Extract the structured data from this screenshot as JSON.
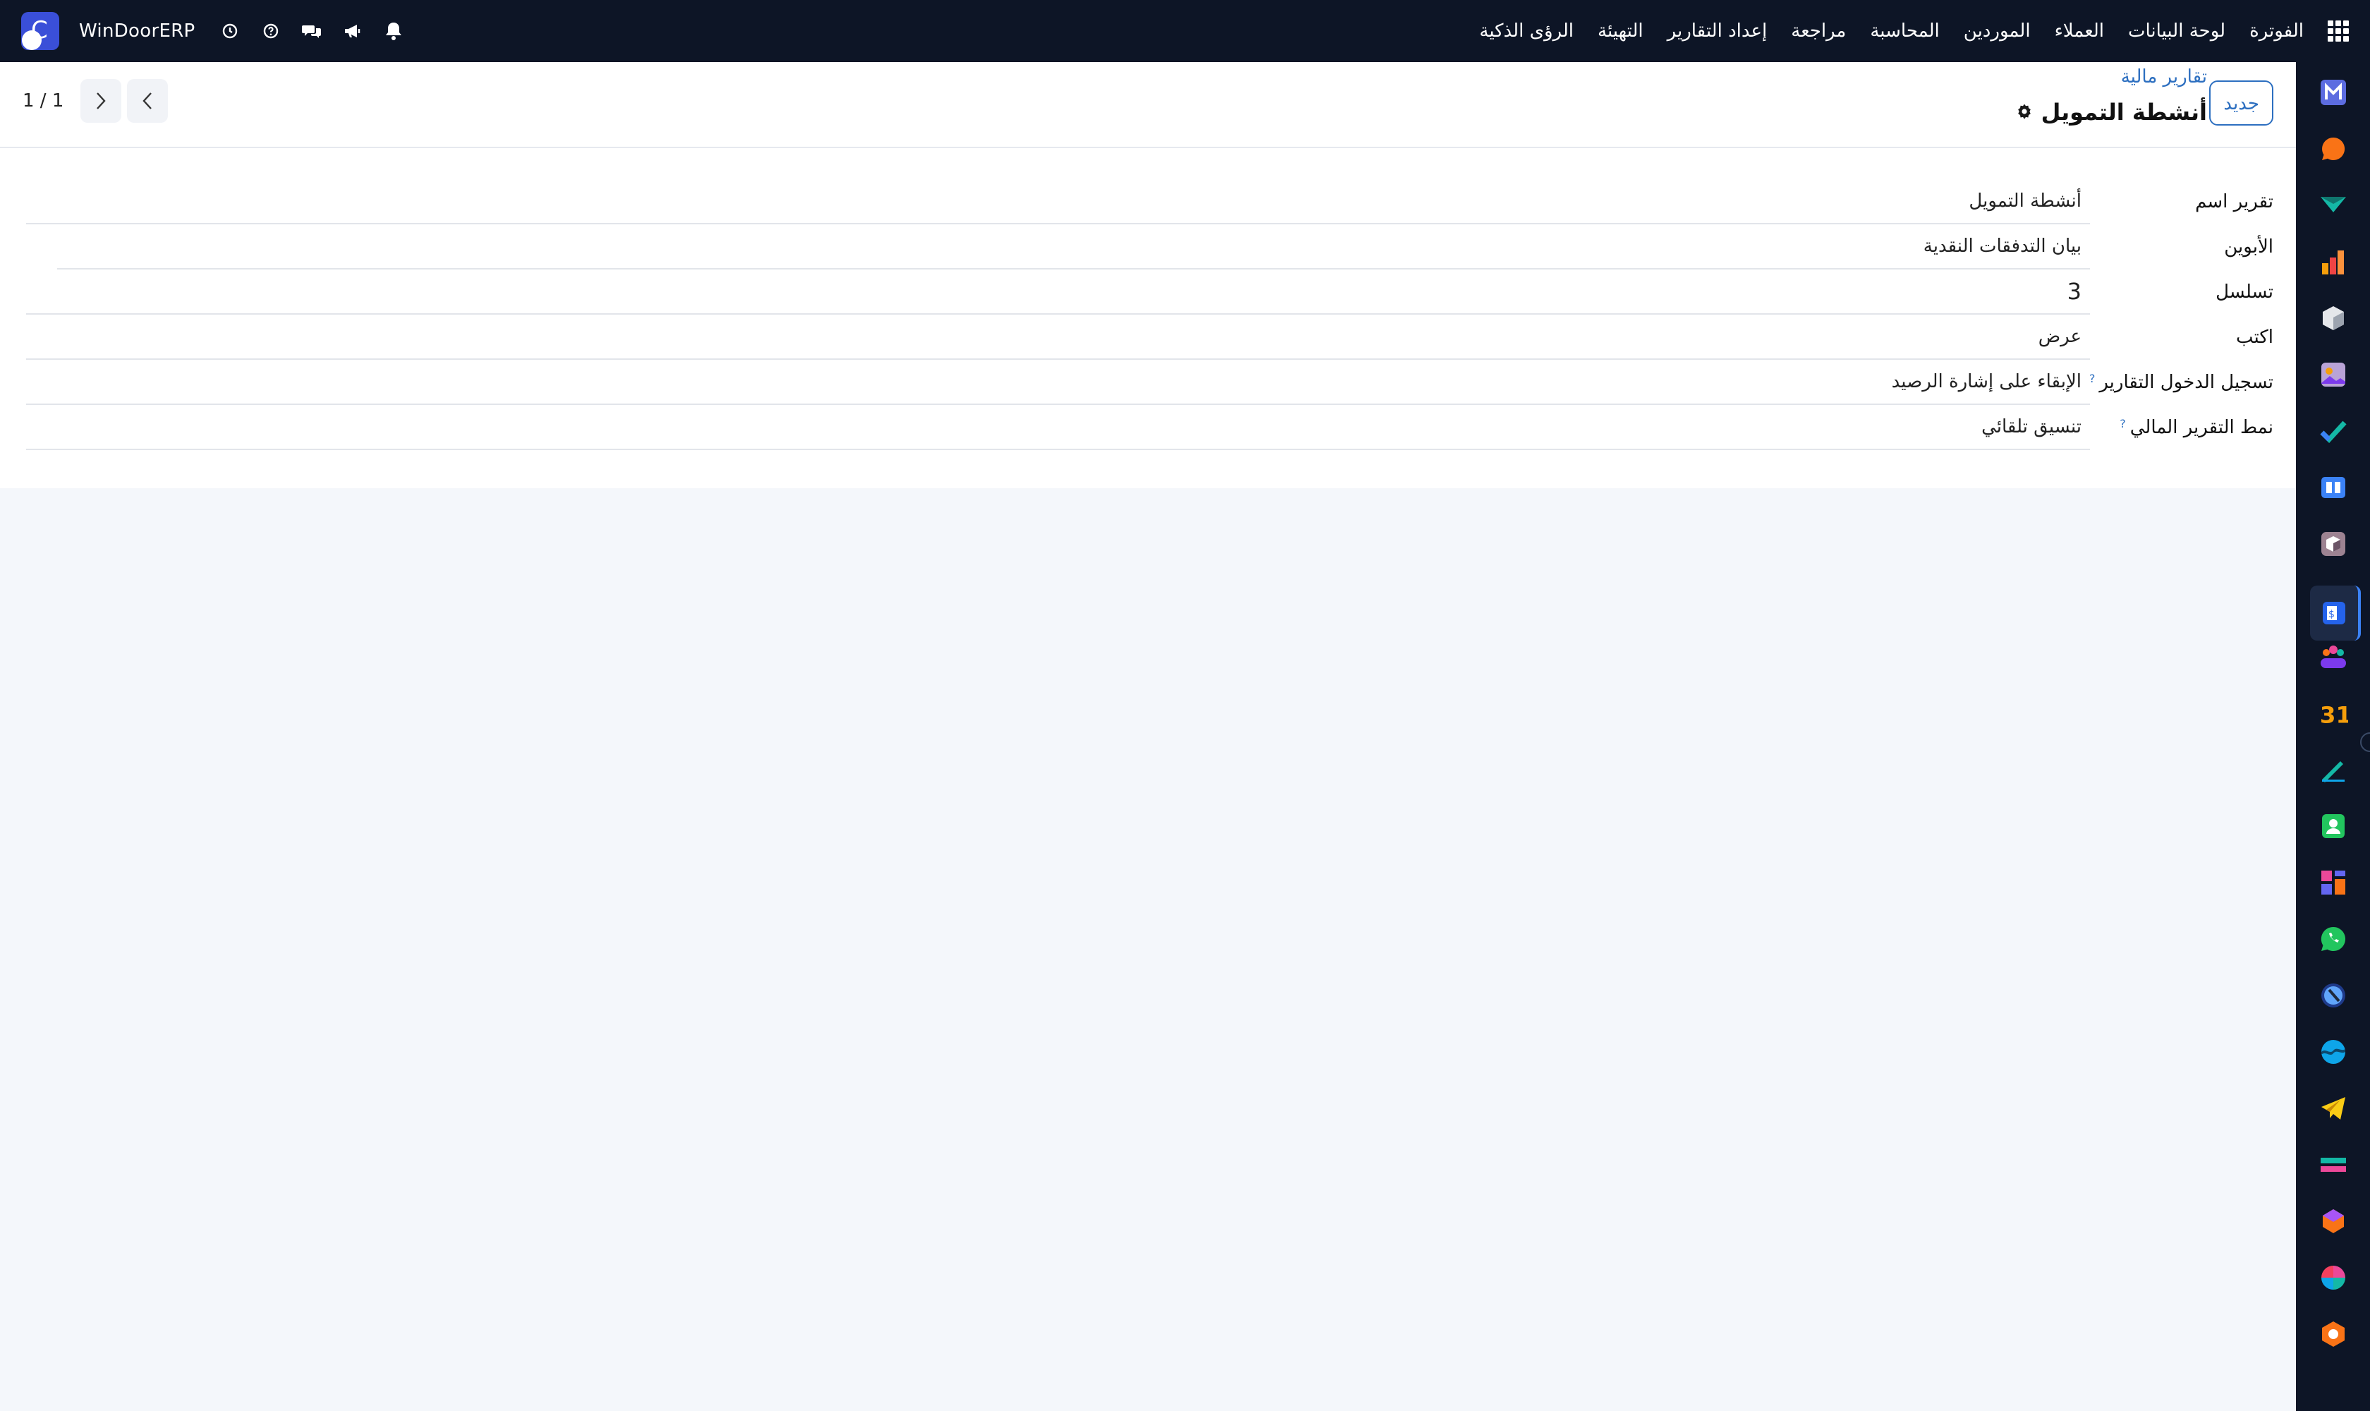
{
  "brand": "WinDoorERP",
  "topbar": {
    "menu": [
      "الفوترة",
      "لوحة البيانات",
      "العملاء",
      "الموردين",
      "المحاسبة",
      "مراجعة",
      "إعداد التقارير",
      "التهيئة",
      "الرؤى الذكية"
    ]
  },
  "control_panel": {
    "new_button": "جديد",
    "breadcrumb": "تقارير مالية",
    "record_title": "أنشطة التمويل",
    "pager": "1 / 1"
  },
  "form": {
    "fields": [
      {
        "label": "تقرير اسم",
        "value": "أنشطة التمويل"
      },
      {
        "label": "الأبوين",
        "value": "بيان التدفقات النقدية"
      },
      {
        "label": "تسلسل",
        "value": "3"
      },
      {
        "label": "اكتب",
        "value": "عرض"
      },
      {
        "label": "تسجيل الدخول التقارير",
        "value": "الإبقاء على إشارة الرصيد",
        "help": "?"
      },
      {
        "label": "نمط التقرير المالي",
        "value": "تنسيق تلقائي",
        "help": "?"
      }
    ]
  },
  "colors": {
    "navbar": "#0d1526",
    "accent": "#2d6fc0",
    "background": "#f4f7fb"
  },
  "sidebar_apps": [
    "m-app-icon",
    "chat-bubble-icon",
    "mail-check-icon",
    "bar-chart-icon",
    "cube-icon",
    "photo-icon",
    "checkmark-icon",
    "book-icon",
    "package-icon",
    "invoicing-icon",
    "team-icon",
    "calendar-icon",
    "sign-icon",
    "contacts-icon",
    "dashboard-icon",
    "whatsapp-icon",
    "compass-icon",
    "ocean-icon",
    "telegram-icon",
    "stripe-icon",
    "gem-icon",
    "pie-chart-icon",
    "hexagon-icon"
  ],
  "calendar_text": "31"
}
